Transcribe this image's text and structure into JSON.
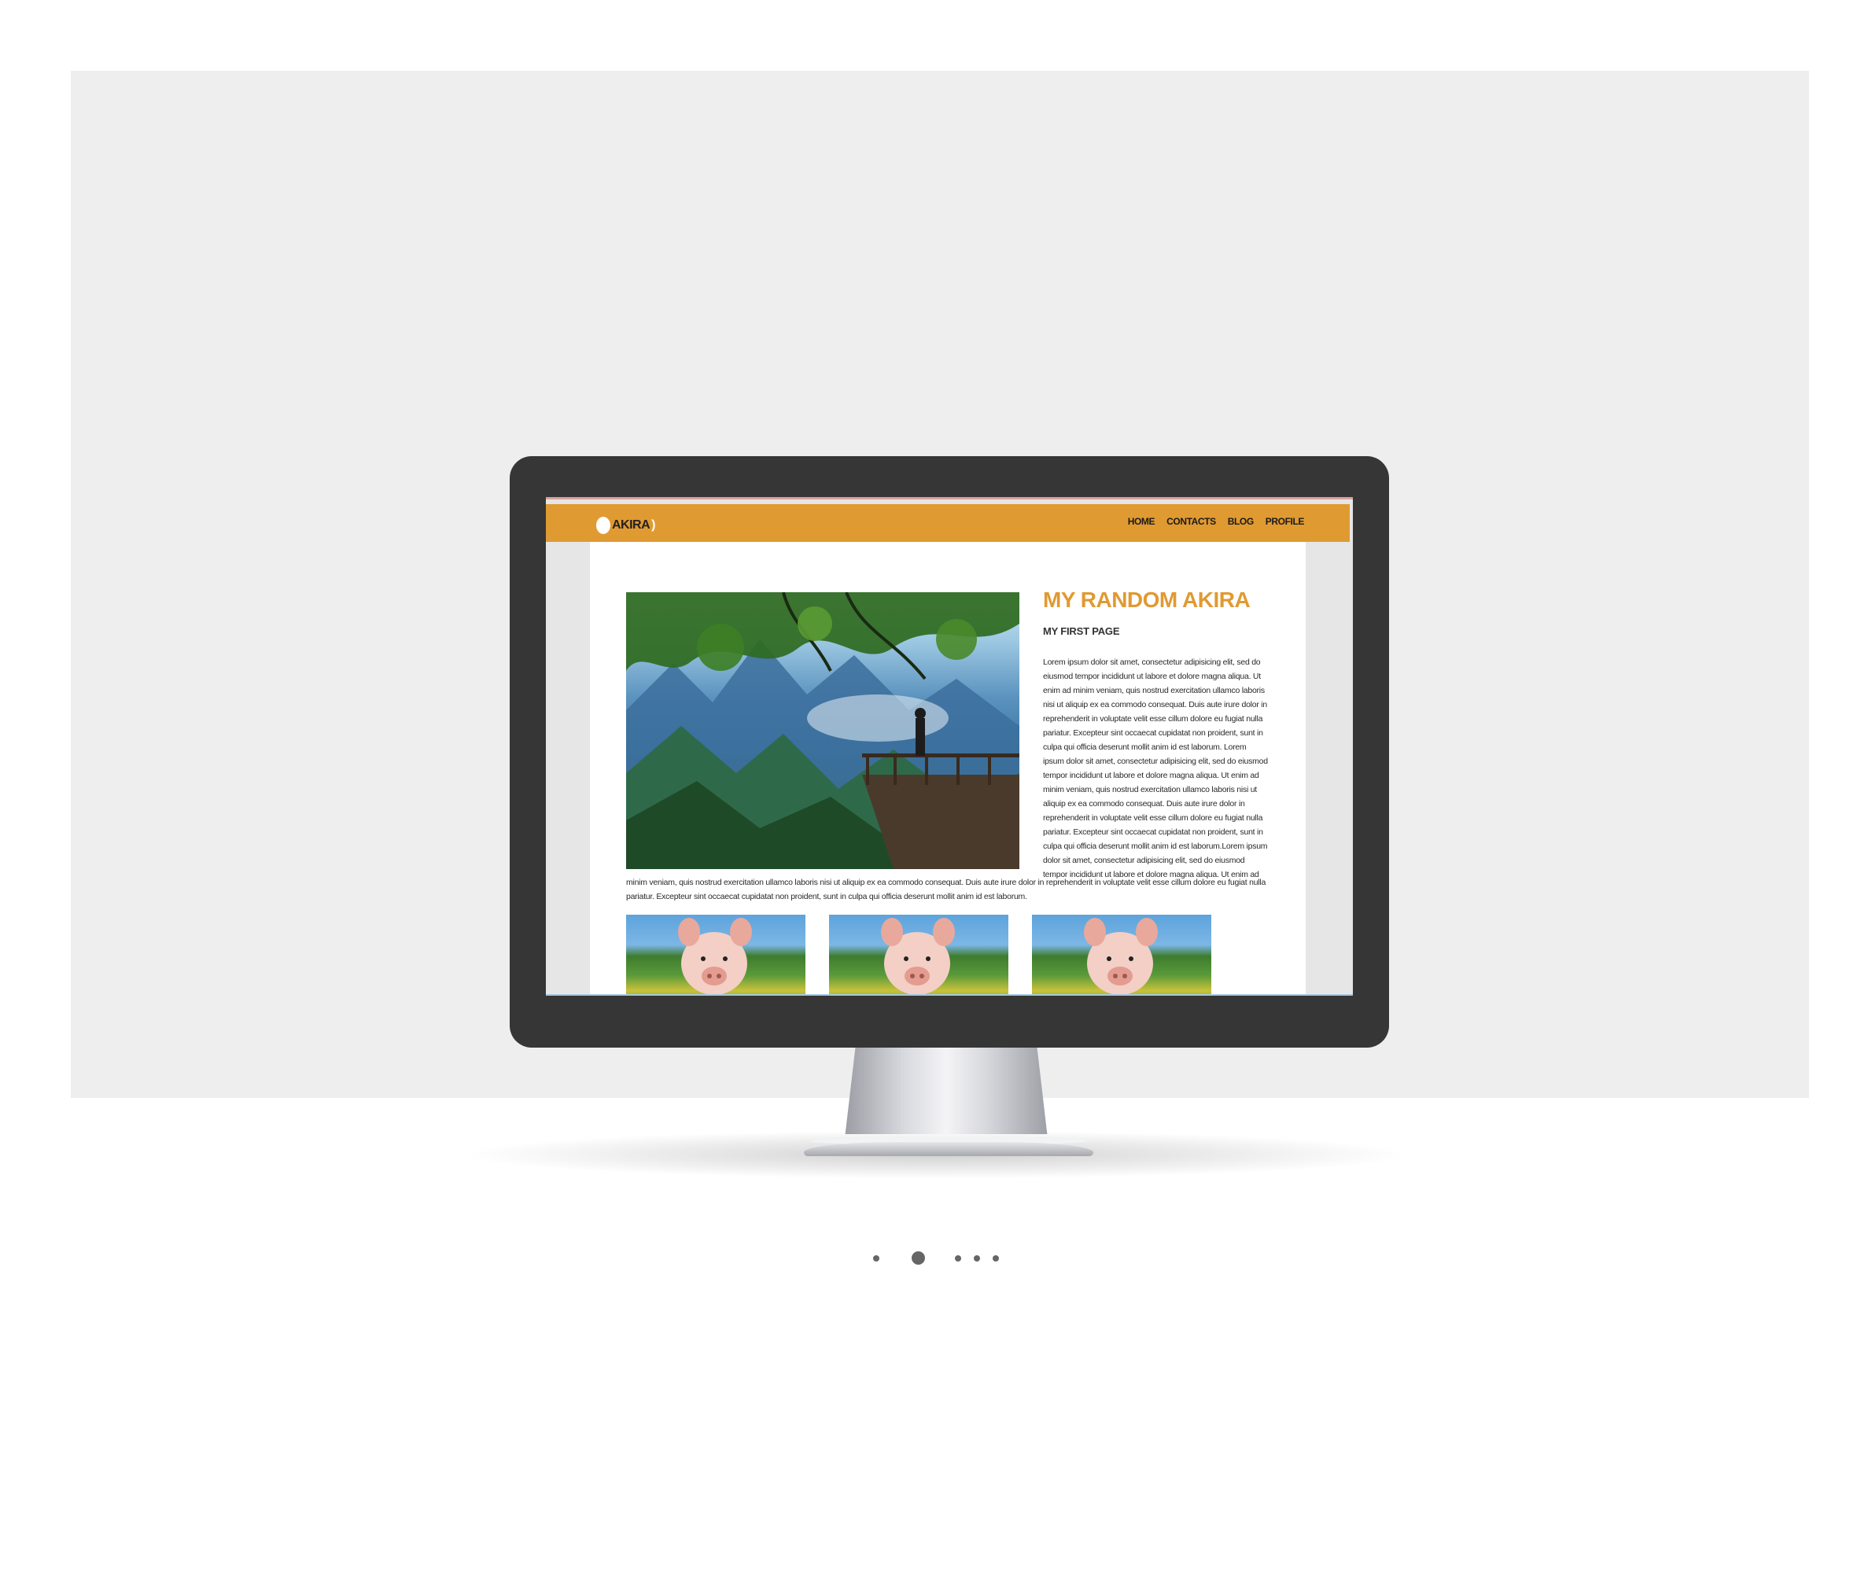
{
  "site": {
    "logo_text": "AKIRA",
    "logo_paren": ")",
    "nav": [
      "HOME",
      "CONTACTS",
      "BLOG",
      "PROFILE"
    ]
  },
  "main": {
    "title": "MY RANDOM AKIRA",
    "subtitle": "MY FIRST PAGE",
    "body_side": "Lorem ipsum dolor sit amet, consectetur adipisicing elit, sed do eiusmod tempor incididunt ut labore et dolore magna aliqua. Ut enim ad minim veniam, quis nostrud exercitation ullamco laboris nisi ut aliquip ex ea commodo consequat. Duis aute irure dolor in reprehenderit in voluptate velit esse cillum dolore eu fugiat nulla pariatur. Excepteur sint occaecat cupidatat non proident, sunt in culpa qui officia deserunt mollit anim id est laborum. Lorem ipsum dolor sit amet, consectetur adipisicing elit, sed do eiusmod tempor incididunt ut labore et dolore magna aliqua. Ut enim ad minim veniam, quis nostrud exercitation ullamco laboris nisi ut aliquip ex ea commodo consequat. Duis aute irure dolor in reprehenderit in voluptate velit esse cillum dolore eu fugiat nulla pariatur. Excepteur sint occaecat cupidatat non proident, sunt in culpa qui officia deserunt mollit anim id est laborum.Lorem ipsum dolor sit amet, consectetur adipisicing elit, sed do eiusmod tempor incididunt ut labore et dolore magna aliqua. Ut enim ad",
    "body_wide": "minim veniam, quis nostrud exercitation ullamco laboris nisi ut aliquip ex ea commodo consequat. Duis aute irure dolor in reprehenderit in voluptate velit esse cillum dolore eu fugiat nulla pariatur. Excepteur sint occaecat cupidatat non proident, sunt in culpa qui officia deserunt mollit anim id est laborum."
  },
  "colors": {
    "accent": "#e09a32",
    "bezel": "#363636",
    "stage": "#eeeeee"
  },
  "carousel": {
    "count": 5,
    "active_index": 1
  }
}
